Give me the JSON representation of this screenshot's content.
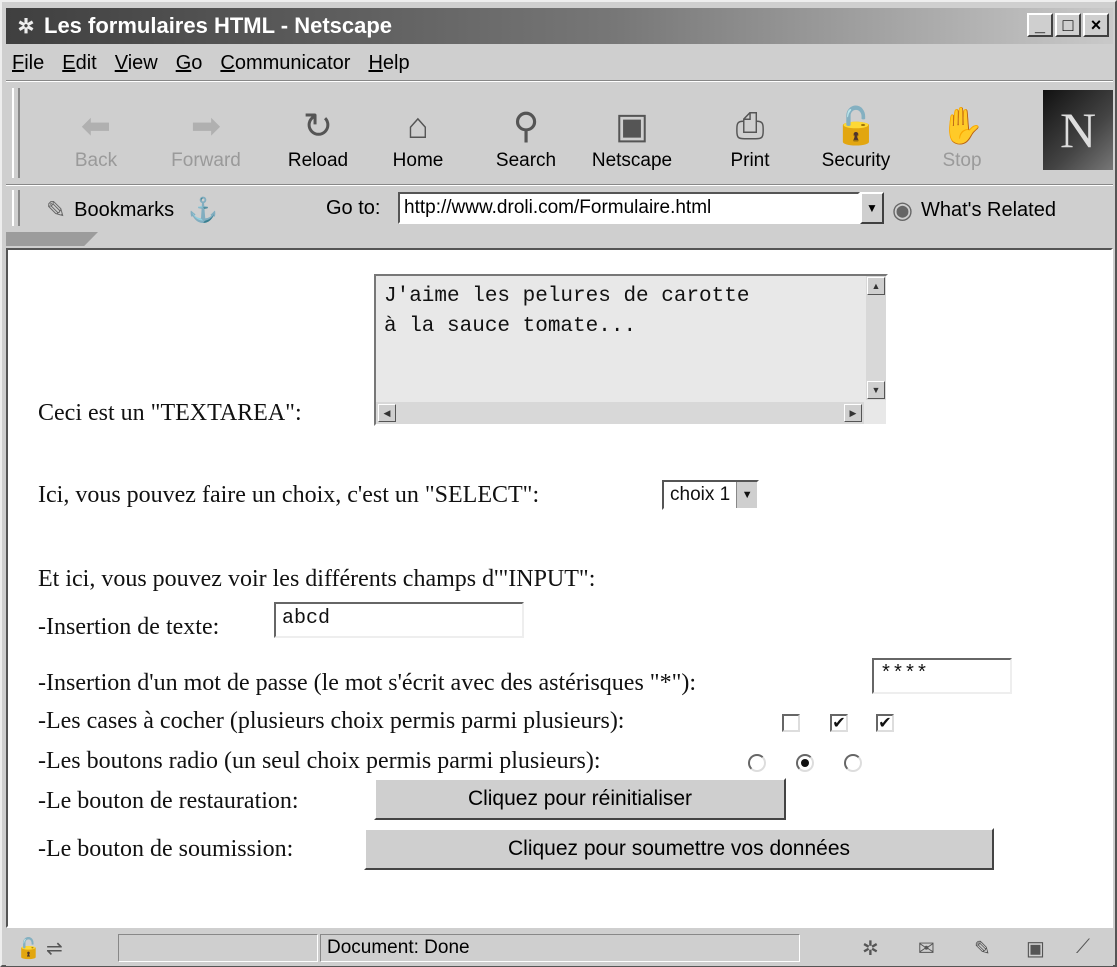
{
  "window": {
    "title": "Les formulaires HTML - Netscape",
    "title_icon": "netscape-window-icon",
    "controls": [
      "_",
      "□",
      "×"
    ]
  },
  "menu": [
    "File",
    "Edit",
    "View",
    "Go",
    "Communicator",
    "Help"
  ],
  "toolbar": {
    "buttons": [
      {
        "label": "Back",
        "icon": "back-arrow-icon",
        "glyph": "⬅",
        "disabled": true
      },
      {
        "label": "Forward",
        "icon": "forward-arrow-icon",
        "glyph": "➡",
        "disabled": true
      },
      {
        "label": "Reload",
        "icon": "reload-icon",
        "glyph": "↻",
        "disabled": false
      },
      {
        "label": "Home",
        "icon": "home-icon",
        "glyph": "⌂",
        "disabled": false
      },
      {
        "label": "Search",
        "icon": "search-icon",
        "glyph": "⚲",
        "disabled": false
      },
      {
        "label": "Netscape",
        "icon": "my-netscape-icon",
        "glyph": "▣",
        "disabled": false
      },
      {
        "label": "Print",
        "icon": "print-icon",
        "glyph": "⎙",
        "disabled": false
      },
      {
        "label": "Security",
        "icon": "security-lock-icon",
        "glyph": "🔓",
        "disabled": false
      },
      {
        "label": "Stop",
        "icon": "stop-icon",
        "glyph": "✋",
        "disabled": true
      }
    ],
    "logo": "N"
  },
  "location": {
    "bookmarks_label": "Bookmarks",
    "goto_label": "Go to:",
    "url": "http://www.droli.com/Formulaire.html",
    "related_label": "What's Related"
  },
  "form": {
    "textarea_label": "Ceci est un \"TEXTAREA\":",
    "textarea_value": "J'aime les pelures de carotte\nà la sauce tomate...",
    "select_label": "Ici, vous pouvez faire un choix, c'est un \"SELECT\":",
    "select_value": "choix 1",
    "input_intro": "Et ici, vous pouvez voir les différents champs d'\"INPUT\":",
    "text_label": "-Insertion de texte:",
    "text_value": "abcd",
    "password_label": "-Insertion d'un mot de passe (le mot s'écrit avec des astérisques \"*\"):",
    "password_value": "****",
    "checkbox_label": "-Les cases à cocher (plusieurs choix permis parmi plusieurs):",
    "checkboxes": [
      false,
      true,
      true
    ],
    "radio_label": "-Les boutons radio (un seul choix permis parmi plusieurs):",
    "radios": [
      false,
      true,
      false
    ],
    "reset_label": "-Le bouton de restauration:",
    "reset_button": "Cliquez pour réinitialiser",
    "submit_label": "-Le bouton de soumission:",
    "submit_button": "Cliquez pour soumettre vos données"
  },
  "status": {
    "text": "Document: Done"
  }
}
